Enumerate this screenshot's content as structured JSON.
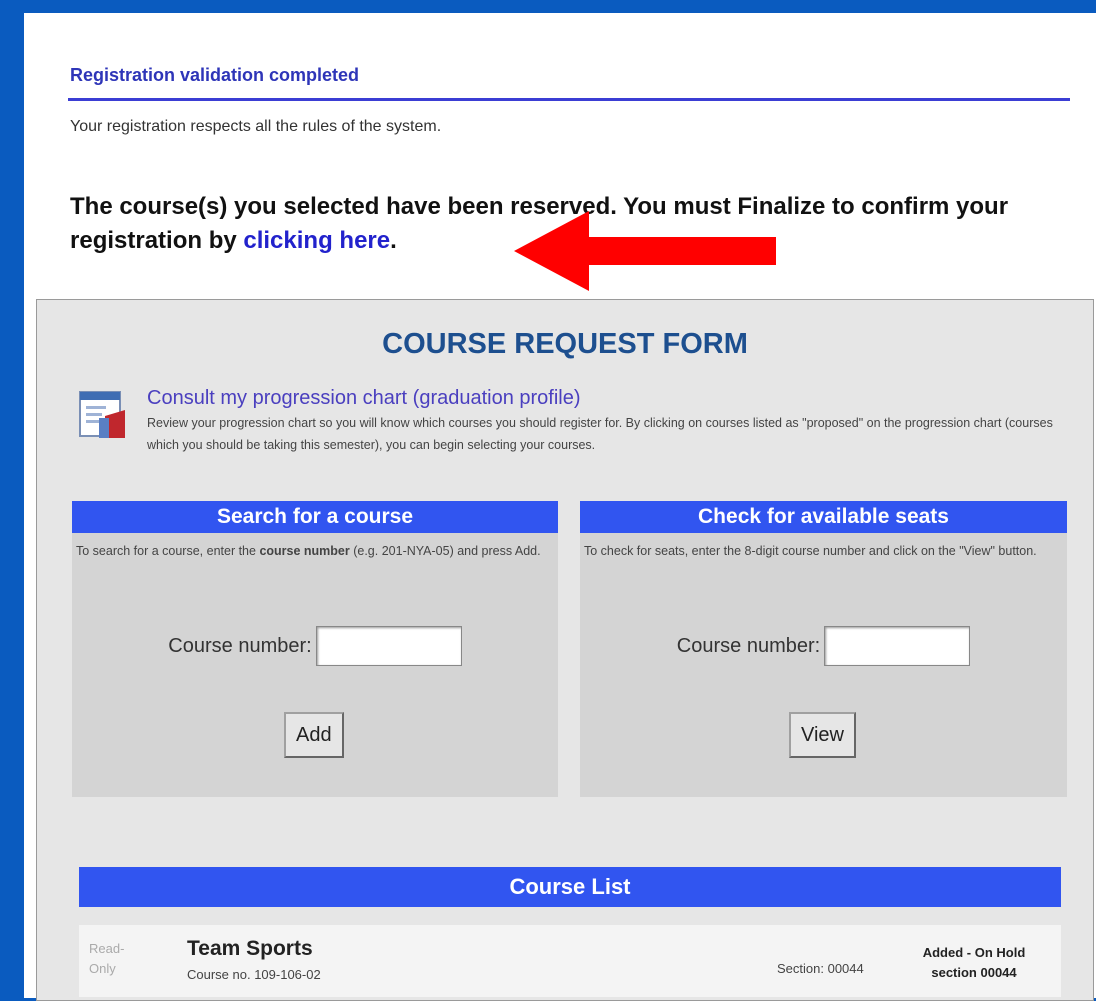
{
  "validation": {
    "title": "Registration validation completed",
    "description": "Your registration respects all the rules of the system."
  },
  "reservation": {
    "text": "The course(s) you selected have been reserved. You must Finalize to confirm your registration by ",
    "link": "clicking here",
    "suffix": "."
  },
  "annotation": {
    "arrow_color": "#ff0000",
    "icon": "arrow-left-icon"
  },
  "form": {
    "title": "COURSE REQUEST FORM",
    "progression": {
      "icon": "progression-chart-icon",
      "link": "Consult my progression chart (graduation profile)",
      "description": "Review your progression chart so you will know which courses you should register for. By clicking on courses listed as \"proposed\" on the progression chart (courses which you should be taking this semester), you can begin selecting your courses."
    },
    "search": {
      "title": "Search for a course",
      "desc_before": "To search for a course, enter the ",
      "desc_bold": "course number",
      "desc_after": " (e.g. 201-NYA-05) and press Add.",
      "field_label": "Course number:",
      "field_value": "",
      "button": "Add"
    },
    "seats": {
      "title": "Check for available seats",
      "description": "To check for seats, enter the 8-digit course number and click on the \"View\" button.",
      "field_label": "Course number:",
      "field_value": "",
      "button": "View"
    }
  },
  "course_list": {
    "title": "Course List",
    "rows": [
      {
        "read_only": "Read-Only",
        "name": "Team Sports",
        "course_no": "Course no. 109-106-02",
        "section": "Section: 00044",
        "status_line1": "Added - On Hold",
        "status_line2": "section 00044"
      }
    ]
  },
  "colors": {
    "accent": "#3155f0",
    "background": "#0a5bbf",
    "link": "#2222cc"
  }
}
